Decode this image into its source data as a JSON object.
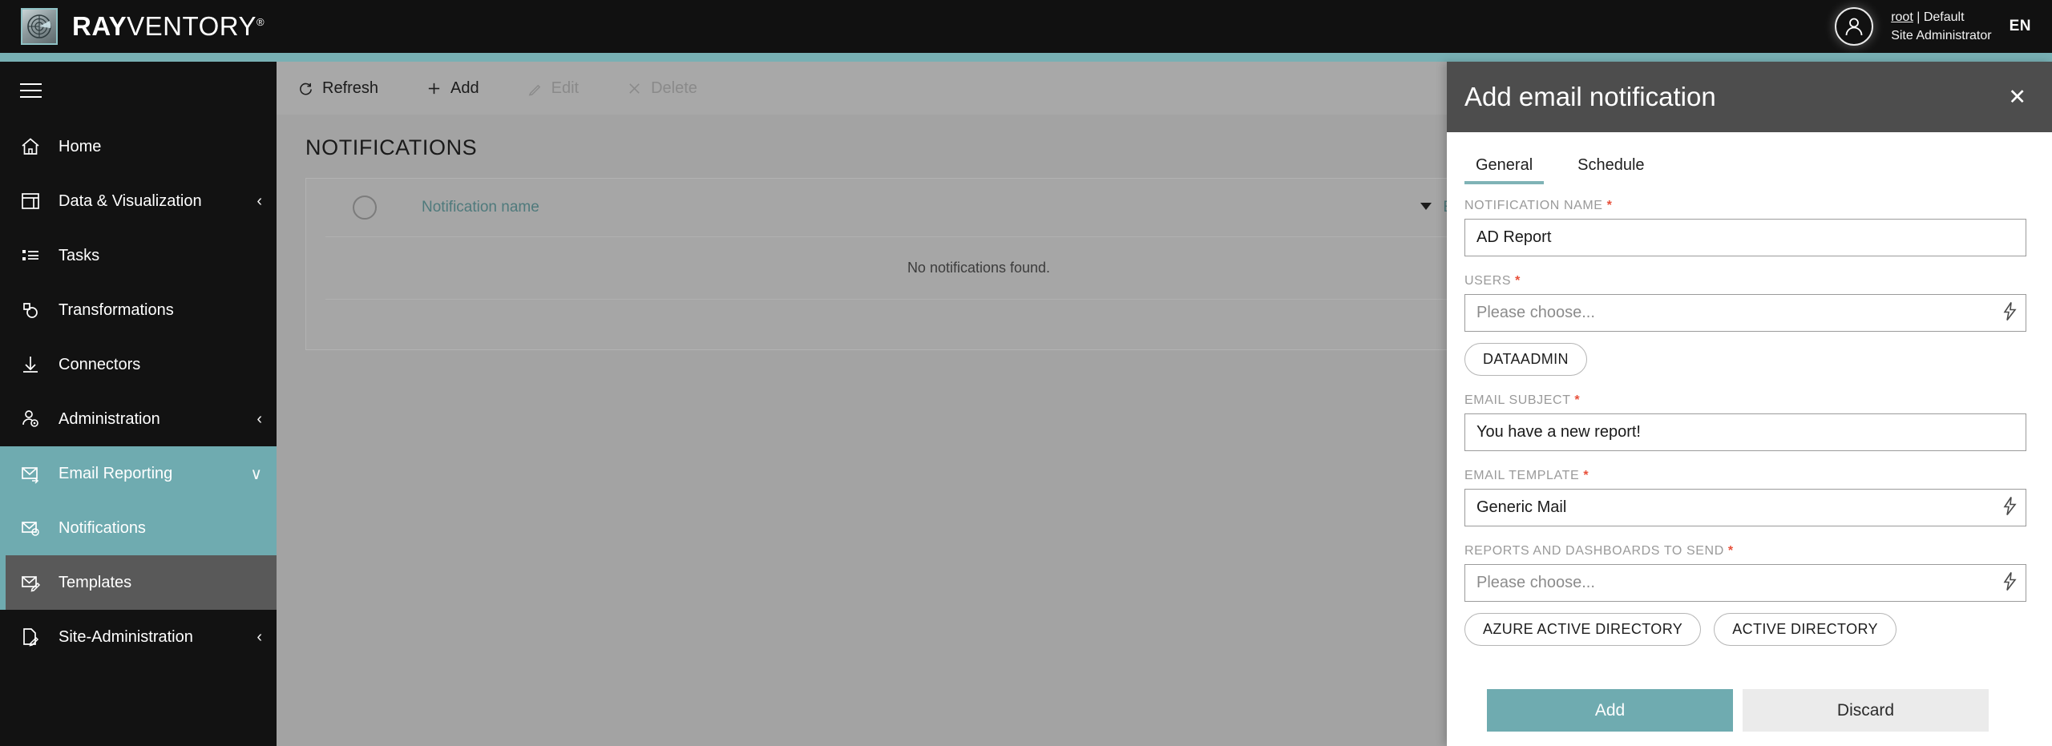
{
  "topbar": {
    "brand_bold": "RAY",
    "brand_light": "VENTORY",
    "brand_reg": "®",
    "logo_icon": "radar-icon",
    "avatar_icon": "user-avatar-icon",
    "user_name": "root",
    "user_separator": " | ",
    "user_tenant": "Default",
    "user_role": "Site Administrator",
    "language": "EN",
    "accent_color": "#78b0b4"
  },
  "sidebar": {
    "menu_icon": "hamburger-menu-icon",
    "items": [
      {
        "label": "Home",
        "icon": "home-icon",
        "chevron": "",
        "state": "normal"
      },
      {
        "label": "Data & Visualization",
        "icon": "dashboard-icon",
        "chevron": "‹",
        "state": "normal"
      },
      {
        "label": "Tasks",
        "icon": "list-icon",
        "chevron": "",
        "state": "normal"
      },
      {
        "label": "Transformations",
        "icon": "transform-icon",
        "chevron": "",
        "state": "normal"
      },
      {
        "label": "Connectors",
        "icon": "download-icon",
        "chevron": "",
        "state": "normal"
      },
      {
        "label": "Administration",
        "icon": "user-gear-icon",
        "chevron": "‹",
        "state": "normal"
      },
      {
        "label": "Email Reporting",
        "icon": "mail-send-icon",
        "chevron": "∨",
        "state": "group-active"
      },
      {
        "label": "Notifications",
        "icon": "mail-bell-icon",
        "chevron": "",
        "state": "group-active"
      },
      {
        "label": "Templates",
        "icon": "mail-edit-icon",
        "chevron": "",
        "state": "selected"
      },
      {
        "label": "Site-Administration",
        "icon": "page-edit-icon",
        "chevron": "‹",
        "state": "normal"
      }
    ]
  },
  "toolbar": {
    "refresh_label": "Refresh",
    "refresh_icon": "refresh-icon",
    "add_label": "Add",
    "add_icon": "plus-icon",
    "edit_label": "Edit",
    "edit_icon": "pencil-icon",
    "delete_label": "Delete",
    "delete_icon": "close-x-icon"
  },
  "main": {
    "page_title": "NOTIFICATIONS",
    "table": {
      "select_all_icon": "select-all-circle-icon",
      "columns": [
        {
          "label": "Notification name",
          "icon": ""
        },
        {
          "label": "Email template",
          "icon": "filter-caret-icon"
        }
      ],
      "empty_message": "No notifications found.",
      "rows": []
    }
  },
  "panel": {
    "title": "Add email notification",
    "close_icon": "close-icon",
    "tabs": [
      {
        "label": "General",
        "active": true
      },
      {
        "label": "Schedule",
        "active": false
      }
    ],
    "fields": [
      {
        "label": "NOTIFICATION NAME",
        "required": "*",
        "value": "AD Report",
        "placeholder": "",
        "is_placeholder": false,
        "has_bolt": false,
        "chips": []
      },
      {
        "label": "USERS",
        "required": "*",
        "value": "Please choose...",
        "placeholder": "Please choose...",
        "is_placeholder": true,
        "has_bolt": true,
        "bolt_icon": "lightning-icon",
        "chips": [
          "DATAADMIN"
        ]
      },
      {
        "label": "EMAIL SUBJECT",
        "required": "*",
        "value": "You have a new report!",
        "placeholder": "",
        "is_placeholder": false,
        "has_bolt": false,
        "chips": []
      },
      {
        "label": "EMAIL TEMPLATE",
        "required": "*",
        "value": "Generic Mail",
        "placeholder": "",
        "is_placeholder": false,
        "has_bolt": true,
        "bolt_icon": "lightning-icon",
        "chips": []
      },
      {
        "label": "REPORTS AND DASHBOARDS TO SEND",
        "required": "*",
        "value": "Please choose...",
        "placeholder": "Please choose...",
        "is_placeholder": true,
        "has_bolt": true,
        "bolt_icon": "lightning-icon",
        "chips": [
          "AZURE ACTIVE DIRECTORY",
          "ACTIVE DIRECTORY"
        ]
      }
    ],
    "add_button": "Add",
    "discard_button": "Discard",
    "primary_color": "#6fabb0"
  }
}
